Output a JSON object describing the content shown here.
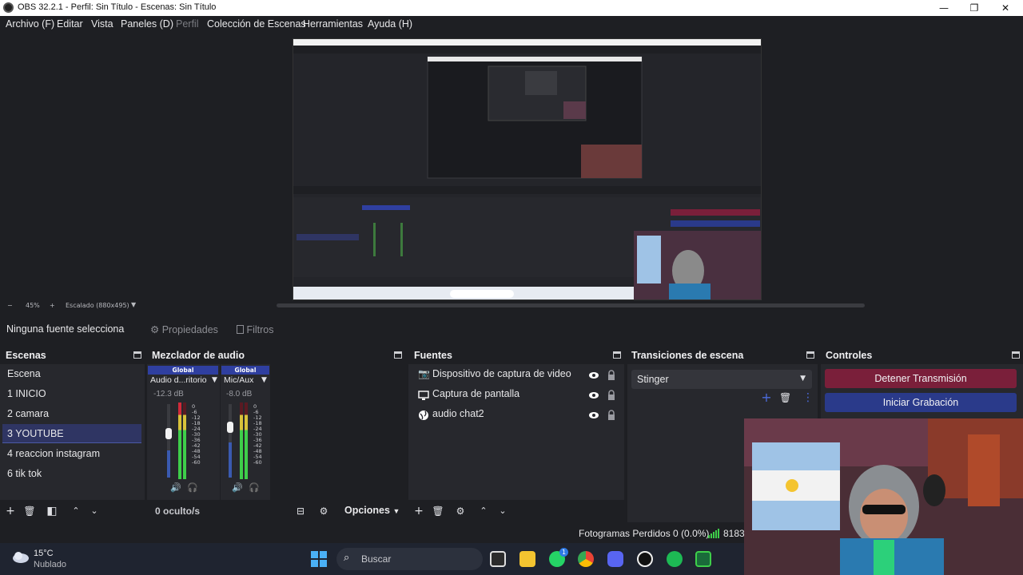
{
  "window": {
    "title": "OBS 32.2.1 - Perfil: Sin Título - Escenas: Sin Título",
    "minimize": "—",
    "maximize": "❐",
    "close": "✕"
  },
  "menu": {
    "archivo": "Archivo (F)",
    "editar": "Editar",
    "vista": "Vista",
    "paneles": "Paneles (D)",
    "perfil": "Perfil",
    "coleccion": "Colección de Escenas",
    "herramientas": "Herramientas",
    "ayuda": "Ayuda (H)"
  },
  "preview_toolbar": {
    "minus": "−",
    "zoom": "45%",
    "plus": "+",
    "scale": "Escalado (880x495)"
  },
  "context": {
    "no_source": "Ninguna fuente selecciona",
    "properties": "Propiedades",
    "filters": "Filtros"
  },
  "scenes": {
    "title": "Escenas",
    "items": [
      "Escena",
      "1 INICIO",
      "2 camara",
      "3 YOUTUBE",
      "4 reaccion instagram",
      "6 tik tok"
    ],
    "selected": "3 YOUTUBE"
  },
  "mixer": {
    "title": "Mezclador de audio",
    "channels": [
      {
        "tag": "Global",
        "name": "Audio d...ritorio",
        "db": "-12.3 dB",
        "volume_percent": 55
      },
      {
        "tag": "Global",
        "name": "Mic/Aux",
        "db": "-8.0 dB",
        "volume_percent": 65
      }
    ],
    "scale": [
      "0",
      "-6",
      "-12",
      "-18",
      "-24",
      "-30",
      "-36",
      "-42",
      "-48",
      "-54",
      "-60"
    ],
    "hidden": "0 oculto/s",
    "options": "Opciones"
  },
  "sources": {
    "title": "Fuentes",
    "items": [
      "Dispositivo de captura de video",
      "Captura de pantalla",
      "audio chat2"
    ]
  },
  "transitions": {
    "title": "Transiciones de escena",
    "selected": "Stinger"
  },
  "controls": {
    "title": "Controles",
    "stop_stream": "Detener Transmisión",
    "start_recording": "Iniciar Grabación",
    "stop_color": "#7a1f3a",
    "record_color": "#2a3a8a"
  },
  "status": {
    "dropped": "Fotogramas Perdidos 0 (0.0%)",
    "bitrate": "8183"
  },
  "taskbar": {
    "temp": "15°C",
    "weather": "Nublado",
    "search": "Buscar",
    "badge": "1"
  }
}
